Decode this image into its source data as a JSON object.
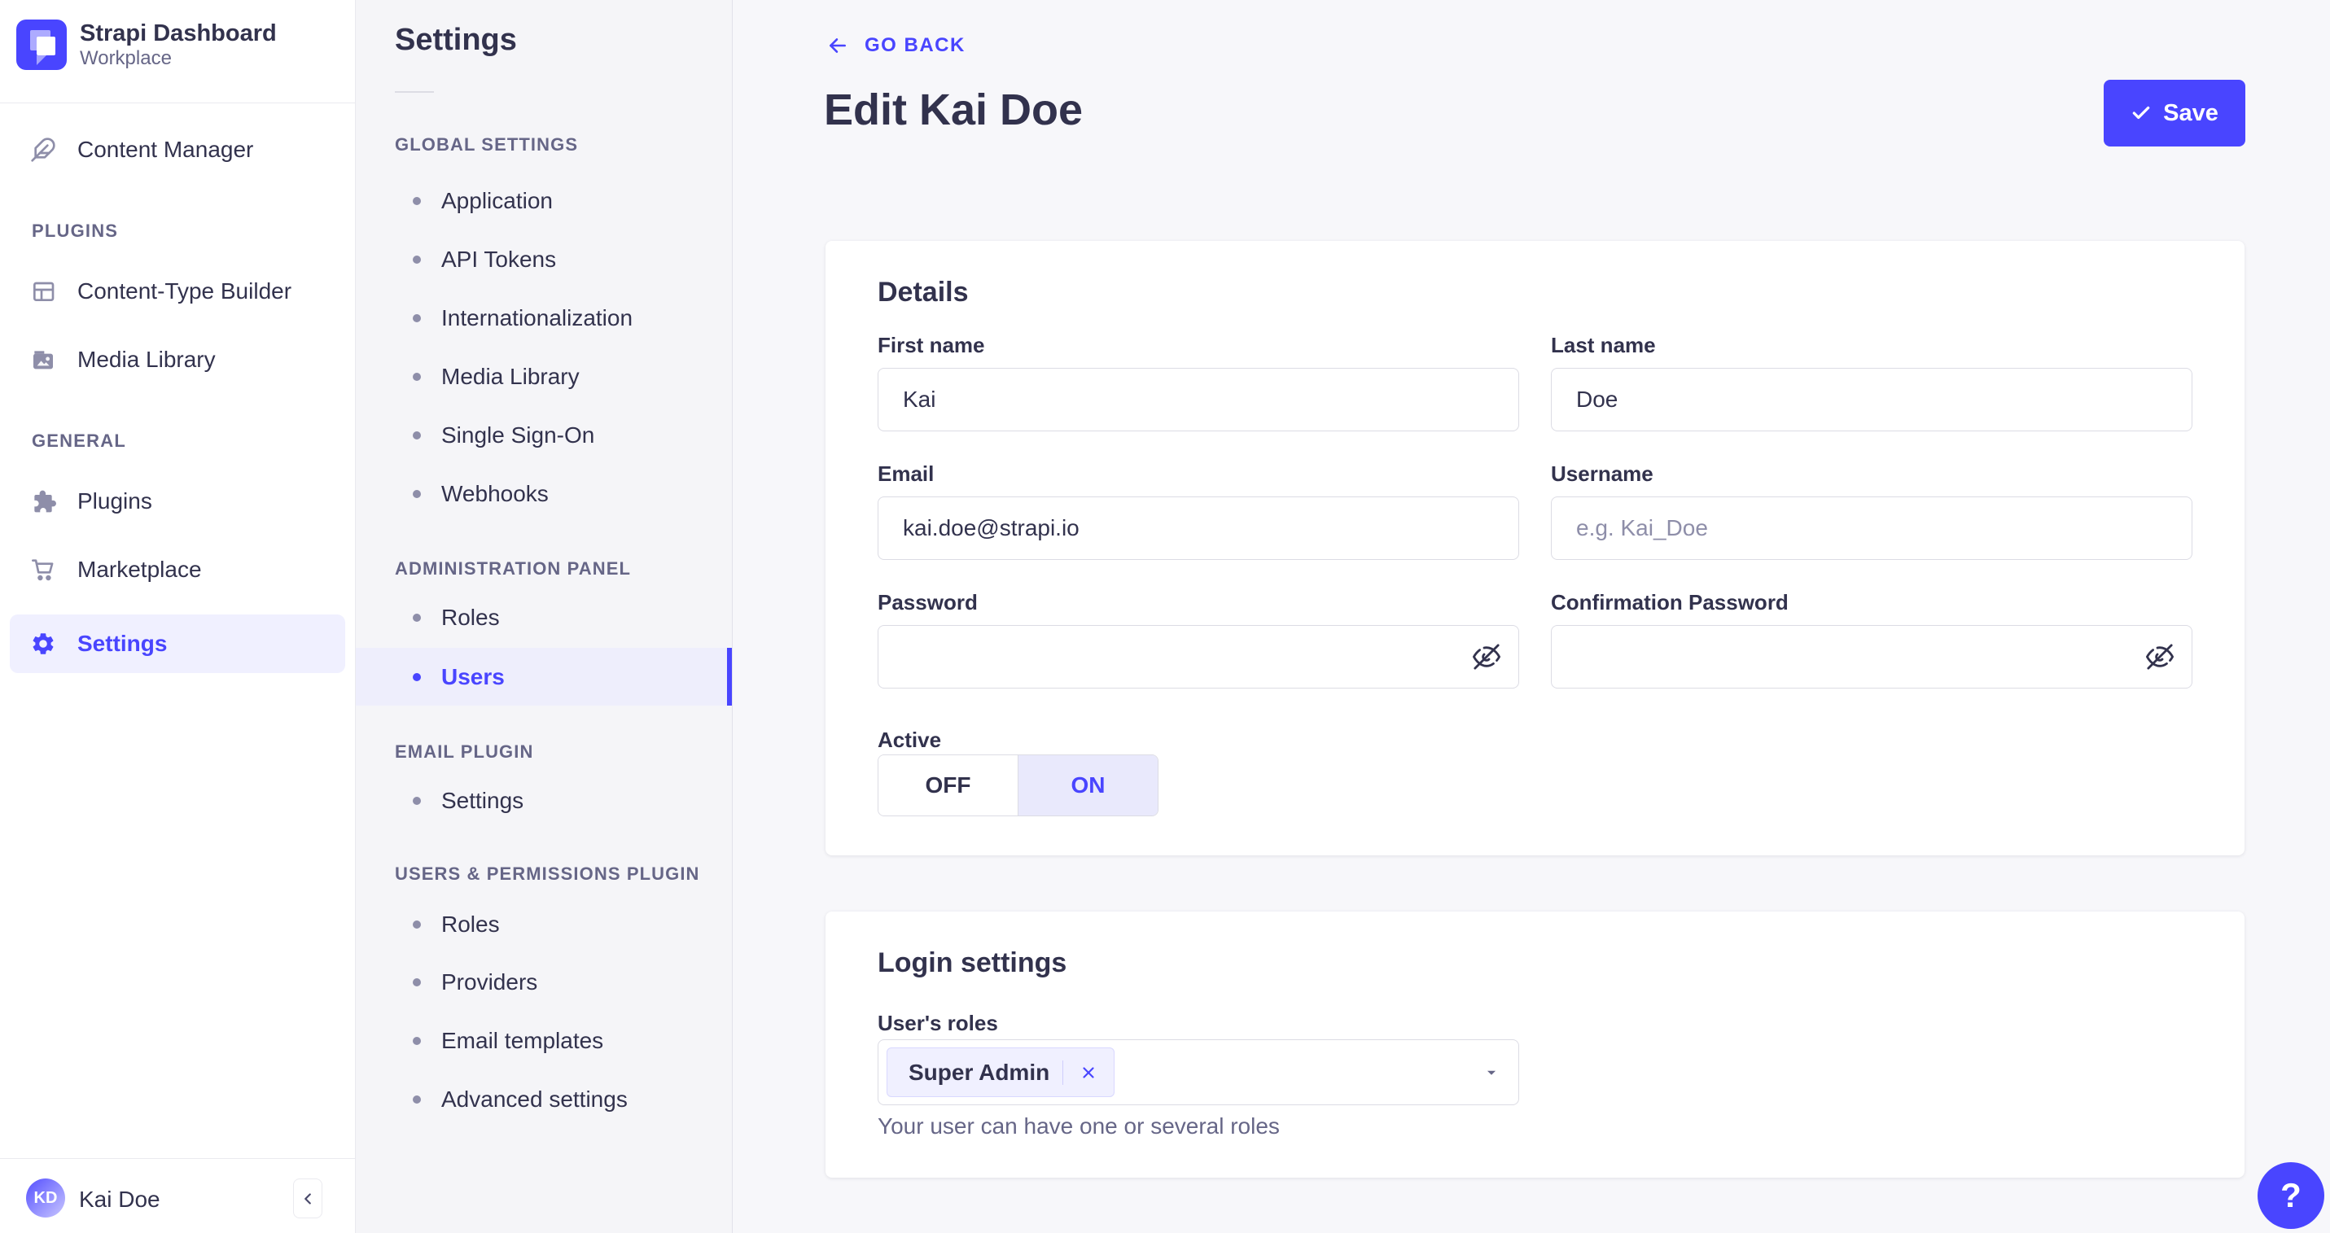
{
  "colors": {
    "accent": "#4945ff",
    "accent_light": "#f0f0ff",
    "text_dark": "#32324d",
    "text_muted": "#666687",
    "border": "#dcdce4"
  },
  "app": {
    "name": "Strapi Dashboard",
    "workspace": "Workplace",
    "user": {
      "name": "Kai Doe",
      "initials": "KD"
    }
  },
  "sidebar": {
    "groups": [
      {
        "header": "",
        "items": [
          {
            "label": "Content Manager",
            "icon": "feather-icon"
          }
        ]
      },
      {
        "header": "PLUGINS",
        "items": [
          {
            "label": "Content-Type Builder",
            "icon": "layout-icon"
          },
          {
            "label": "Media Library",
            "icon": "picture-icon"
          }
        ]
      },
      {
        "header": "GENERAL",
        "items": [
          {
            "label": "Plugins",
            "icon": "puzzle-icon"
          },
          {
            "label": "Marketplace",
            "icon": "cart-icon"
          },
          {
            "label": "Settings",
            "icon": "gear-icon",
            "active": true
          }
        ]
      }
    ]
  },
  "settings_nav": {
    "title": "Settings",
    "sections": [
      {
        "header": "GLOBAL SETTINGS",
        "items": [
          "Application",
          "API Tokens",
          "Internationalization",
          "Media Library",
          "Single Sign-On",
          "Webhooks"
        ]
      },
      {
        "header": "ADMINISTRATION PANEL",
        "items": [
          "Roles",
          "Users"
        ],
        "active_item": "Users"
      },
      {
        "header": "EMAIL PLUGIN",
        "items": [
          "Settings"
        ]
      },
      {
        "header": "USERS & PERMISSIONS PLUGIN",
        "items": [
          "Roles",
          "Providers",
          "Email templates",
          "Advanced settings"
        ]
      }
    ]
  },
  "header": {
    "back_label": "GO BACK",
    "title": "Edit Kai Doe",
    "save_label": "Save"
  },
  "details": {
    "title": "Details",
    "fields": {
      "first_name": {
        "label": "First name",
        "value": "Kai"
      },
      "last_name": {
        "label": "Last name",
        "value": "Doe"
      },
      "email": {
        "label": "Email",
        "value": "kai.doe@strapi.io"
      },
      "username": {
        "label": "Username",
        "placeholder": "e.g. Kai_Doe",
        "value": ""
      },
      "password": {
        "label": "Password",
        "value": ""
      },
      "confirmation_password": {
        "label": "Confirmation Password",
        "value": ""
      },
      "active": {
        "label": "Active",
        "off": "OFF",
        "on": "ON",
        "value": "ON"
      }
    }
  },
  "login_settings": {
    "title": "Login settings",
    "roles": {
      "label": "User's roles",
      "selected": [
        "Super Admin"
      ],
      "hint": "Your user can have one or several roles"
    }
  },
  "help": {
    "label": "?"
  }
}
